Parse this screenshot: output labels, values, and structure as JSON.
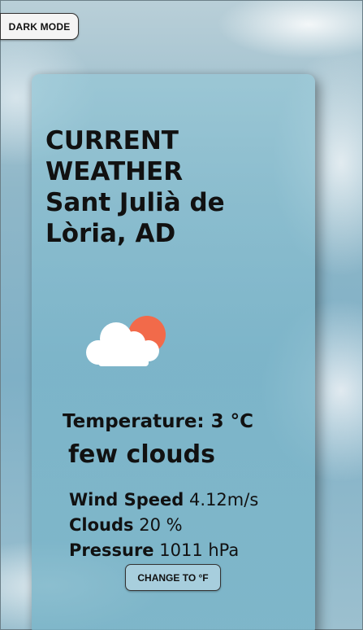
{
  "theme_toggle": {
    "label": "DARK MODE"
  },
  "weather": {
    "heading_line1": "CURRENT",
    "heading_line2": "WEATHER",
    "location_line1": "Sant Julià de",
    "location_line2": "Lòria, AD",
    "icon": "few-clouds-day-icon",
    "temperature_label": "Temperature: 3 °C",
    "description": "few clouds",
    "wind_label": "Wind Speed",
    "wind_value": "4.12m/s",
    "clouds_label": "Clouds",
    "clouds_value": "20 %",
    "pressure_label": "Pressure",
    "pressure_value": "1011 hPa"
  },
  "unit_toggle": {
    "label": "CHANGE TO °F"
  },
  "colors": {
    "sun": "#f26a4a",
    "cloud": "#ffffff",
    "text": "#111111"
  }
}
